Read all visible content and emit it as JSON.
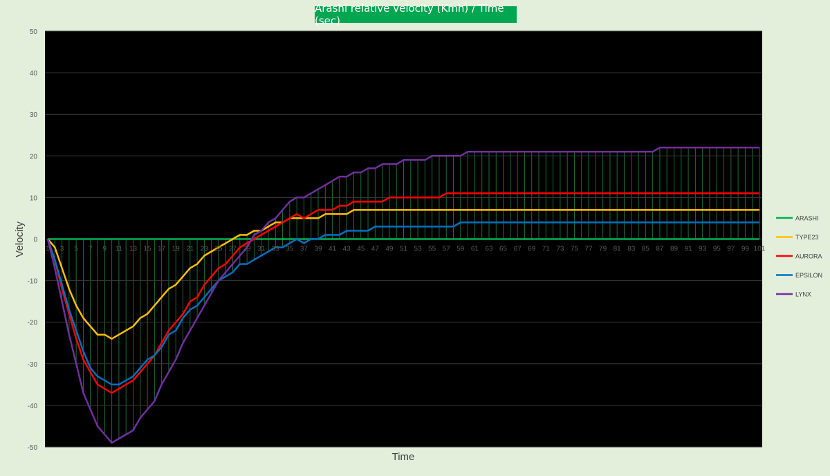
{
  "chart_data": {
    "type": "line",
    "title": "Arashi relative velocity (Kmh) / Time (sec)",
    "xlabel": "Time",
    "ylabel": "Velocity",
    "ylim": [
      -50,
      50
    ],
    "yticks": [
      50,
      40,
      30,
      20,
      10,
      0,
      -10,
      -20,
      -30,
      -40,
      -50
    ],
    "xlim": [
      1,
      101
    ],
    "xtick_labels": [
      "1",
      "3",
      "5",
      "7",
      "9",
      "11",
      "13",
      "15",
      "17",
      "19",
      "21",
      "23",
      "25",
      "27",
      "29",
      "31",
      "33",
      "35",
      "37",
      "39",
      "41",
      "43",
      "45",
      "47",
      "49",
      "51",
      "53",
      "55",
      "57",
      "59",
      "61",
      "63",
      "65",
      "67",
      "69",
      "71",
      "73",
      "75",
      "77",
      "79",
      "81",
      "83",
      "85",
      "87",
      "89",
      "91",
      "93",
      "95",
      "97",
      "99",
      "101"
    ],
    "grid": "horizontal",
    "drop_lines": true,
    "legend_position": "right",
    "series": [
      {
        "name": "ARASHI",
        "color": "#00b050",
        "points": [
          [
            1,
            0
          ],
          [
            101,
            0
          ]
        ]
      },
      {
        "name": "TYPE23",
        "color": "#ffc000",
        "points": [
          [
            1,
            0
          ],
          [
            2,
            -2
          ],
          [
            3,
            -7
          ],
          [
            4,
            -12
          ],
          [
            5,
            -16
          ],
          [
            6,
            -19
          ],
          [
            7,
            -21
          ],
          [
            8,
            -23
          ],
          [
            9,
            -23
          ],
          [
            10,
            -24
          ],
          [
            11,
            -23
          ],
          [
            12,
            -22
          ],
          [
            13,
            -21
          ],
          [
            14,
            -19
          ],
          [
            15,
            -18
          ],
          [
            16,
            -16
          ],
          [
            17,
            -14
          ],
          [
            18,
            -12
          ],
          [
            19,
            -11
          ],
          [
            20,
            -9
          ],
          [
            21,
            -7
          ],
          [
            22,
            -6
          ],
          [
            23,
            -4
          ],
          [
            24,
            -3
          ],
          [
            25,
            -2
          ],
          [
            26,
            -1
          ],
          [
            27,
            0
          ],
          [
            28,
            1
          ],
          [
            29,
            1
          ],
          [
            30,
            2
          ],
          [
            31,
            2
          ],
          [
            32,
            3
          ],
          [
            33,
            4
          ],
          [
            34,
            4
          ],
          [
            35,
            5
          ],
          [
            37,
            5
          ],
          [
            39,
            5
          ],
          [
            40,
            6
          ],
          [
            43,
            6
          ],
          [
            44,
            7
          ],
          [
            101,
            7
          ]
        ]
      },
      {
        "name": "AURORA",
        "color": "#ff0000",
        "points": [
          [
            1,
            0
          ],
          [
            2,
            -5
          ],
          [
            3,
            -12
          ],
          [
            4,
            -18
          ],
          [
            5,
            -24
          ],
          [
            6,
            -29
          ],
          [
            7,
            -32
          ],
          [
            8,
            -35
          ],
          [
            9,
            -36
          ],
          [
            10,
            -37
          ],
          [
            11,
            -36
          ],
          [
            12,
            -35
          ],
          [
            13,
            -34
          ],
          [
            14,
            -32
          ],
          [
            15,
            -30
          ],
          [
            16,
            -28
          ],
          [
            17,
            -25
          ],
          [
            18,
            -22
          ],
          [
            19,
            -20
          ],
          [
            20,
            -18
          ],
          [
            21,
            -15
          ],
          [
            22,
            -14
          ],
          [
            23,
            -11
          ],
          [
            24,
            -9
          ],
          [
            25,
            -7
          ],
          [
            26,
            -6
          ],
          [
            27,
            -4
          ],
          [
            28,
            -2
          ],
          [
            29,
            -1
          ],
          [
            30,
            0
          ],
          [
            31,
            1
          ],
          [
            32,
            2
          ],
          [
            33,
            3
          ],
          [
            34,
            4
          ],
          [
            35,
            5
          ],
          [
            36,
            6
          ],
          [
            37,
            5
          ],
          [
            38,
            6
          ],
          [
            39,
            7
          ],
          [
            41,
            7
          ],
          [
            42,
            8
          ],
          [
            43,
            8
          ],
          [
            44,
            9
          ],
          [
            48,
            9
          ],
          [
            49,
            10
          ],
          [
            56,
            10
          ],
          [
            57,
            11
          ],
          [
            101,
            11
          ]
        ]
      },
      {
        "name": "EPSILON",
        "color": "#0070c0",
        "points": [
          [
            1,
            0
          ],
          [
            2,
            -5
          ],
          [
            3,
            -11
          ],
          [
            4,
            -17
          ],
          [
            5,
            -22
          ],
          [
            6,
            -27
          ],
          [
            7,
            -31
          ],
          [
            8,
            -33
          ],
          [
            9,
            -34
          ],
          [
            10,
            -35
          ],
          [
            11,
            -35
          ],
          [
            12,
            -34
          ],
          [
            13,
            -33
          ],
          [
            14,
            -31
          ],
          [
            15,
            -29
          ],
          [
            16,
            -28
          ],
          [
            17,
            -26
          ],
          [
            18,
            -23
          ],
          [
            19,
            -22
          ],
          [
            20,
            -19
          ],
          [
            21,
            -17
          ],
          [
            22,
            -16
          ],
          [
            23,
            -14
          ],
          [
            24,
            -12
          ],
          [
            25,
            -10
          ],
          [
            26,
            -9
          ],
          [
            27,
            -8
          ],
          [
            28,
            -6
          ],
          [
            29,
            -6
          ],
          [
            30,
            -5
          ],
          [
            31,
            -4
          ],
          [
            32,
            -3
          ],
          [
            33,
            -2
          ],
          [
            34,
            -2
          ],
          [
            35,
            -1
          ],
          [
            36,
            0
          ],
          [
            37,
            -1
          ],
          [
            38,
            0
          ],
          [
            39,
            0
          ],
          [
            40,
            1
          ],
          [
            42,
            1
          ],
          [
            43,
            2
          ],
          [
            46,
            2
          ],
          [
            47,
            3
          ],
          [
            57,
            3
          ],
          [
            58,
            3
          ],
          [
            59,
            4
          ],
          [
            101,
            4
          ]
        ]
      },
      {
        "name": "LYNX",
        "color": "#7030a0",
        "points": [
          [
            1,
            0
          ],
          [
            2,
            -7
          ],
          [
            3,
            -15
          ],
          [
            4,
            -23
          ],
          [
            5,
            -30
          ],
          [
            6,
            -37
          ],
          [
            7,
            -41
          ],
          [
            8,
            -45
          ],
          [
            9,
            -47
          ],
          [
            10,
            -49
          ],
          [
            11,
            -48
          ],
          [
            12,
            -47
          ],
          [
            13,
            -46
          ],
          [
            14,
            -43
          ],
          [
            15,
            -41
          ],
          [
            16,
            -39
          ],
          [
            17,
            -35
          ],
          [
            18,
            -32
          ],
          [
            19,
            -29
          ],
          [
            20,
            -25
          ],
          [
            21,
            -22
          ],
          [
            22,
            -19
          ],
          [
            23,
            -16
          ],
          [
            24,
            -13
          ],
          [
            25,
            -10
          ],
          [
            26,
            -8
          ],
          [
            27,
            -6
          ],
          [
            28,
            -4
          ],
          [
            29,
            -2
          ],
          [
            30,
            1
          ],
          [
            31,
            2
          ],
          [
            32,
            4
          ],
          [
            33,
            5
          ],
          [
            34,
            7
          ],
          [
            35,
            9
          ],
          [
            36,
            10
          ],
          [
            37,
            10
          ],
          [
            38,
            11
          ],
          [
            39,
            12
          ],
          [
            40,
            13
          ],
          [
            41,
            14
          ],
          [
            42,
            15
          ],
          [
            43,
            15
          ],
          [
            44,
            16
          ],
          [
            45,
            16
          ],
          [
            46,
            17
          ],
          [
            47,
            17
          ],
          [
            48,
            18
          ],
          [
            50,
            18
          ],
          [
            51,
            19
          ],
          [
            54,
            19
          ],
          [
            55,
            20
          ],
          [
            59,
            20
          ],
          [
            60,
            21
          ],
          [
            86,
            21
          ],
          [
            87,
            22
          ],
          [
            101,
            22
          ]
        ]
      }
    ]
  }
}
